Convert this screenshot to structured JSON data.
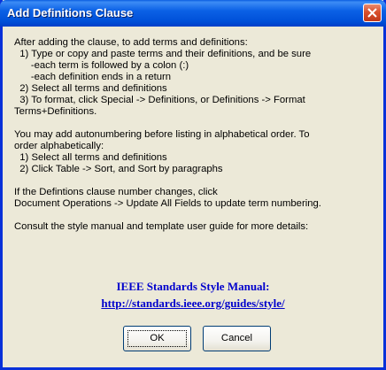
{
  "window": {
    "title": "Add Definitions Clause",
    "close_icon": "close-icon"
  },
  "instructions": {
    "lines_1": [
      "After adding the clause, to add terms and definitions:",
      "  1) Type or copy and paste terms and their definitions, and be sure",
      "      -each term is followed by a colon (:)",
      "      -each definition ends in a return",
      "  2) Select all terms and definitions",
      "  3) To format, click Special -> Definitions, or Definitions -> Format",
      "Terms+Definitions."
    ],
    "lines_2": [
      "You may add autonumbering before listing in alphabetical order. To",
      "order alphabetically:",
      "  1) Select all terms and definitions",
      "  2) Click Table -> Sort, and Sort by paragraphs"
    ],
    "lines_3": [
      "If the Defintions clause number changes, click",
      "Document Operations -> Update All Fields to update term numbering."
    ],
    "lines_4": [
      "Consult the style manual and template user guide for more details:"
    ]
  },
  "manual": {
    "title": "IEEE Standards Style Manual:",
    "link": "http://standards.ieee.org/guides/style/"
  },
  "buttons": {
    "ok_label": "OK",
    "cancel_label": "Cancel"
  }
}
